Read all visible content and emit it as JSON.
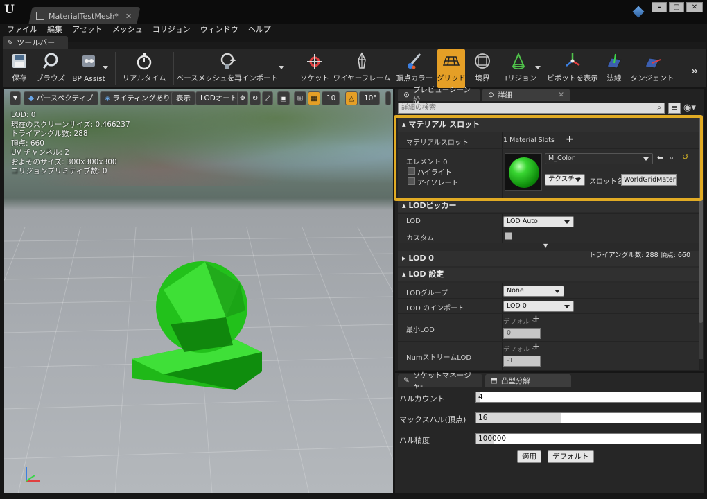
{
  "window": {
    "tab_title": "MaterialTestMesh*",
    "controls": [
      "minimize",
      "maximize",
      "close"
    ]
  },
  "menu": [
    "ファイル",
    "編集",
    "アセット",
    "メッシュ",
    "コリジョン",
    "ウィンドウ",
    "ヘルプ"
  ],
  "toolbar_tab": "ツールバー",
  "toolbar": {
    "save": "保存",
    "browse": "ブラウズ",
    "bp_assist": "BP Assist",
    "realtime": "リアルタイム",
    "reimport": "ベースメッシュを再インポート",
    "socket": "ソケット",
    "wireframe": "ワイヤーフレーム",
    "vertex_colors": "頂点カラー",
    "grid": "グリッド",
    "bounds": "境界",
    "collision": "コリジョン",
    "show_pivot": "ピボットを表示",
    "normals": "法線",
    "tangents": "タンジェント",
    "more": "»"
  },
  "viewport": {
    "perspective": "パースペクティブ",
    "lighting": "ライティングあり",
    "show": "表示",
    "lod_auto": "LODオート",
    "grid_snap": "10",
    "rot_snap": "10°",
    "stats": [
      "LOD: 0",
      "現在のスクリーンサイズ: 0.466237",
      "トライアングル数: 288",
      "頂点: 660",
      "UV チャンネル: 2",
      "およそのサイズ: 300x300x300",
      "コリジョンプリミティブ数: 0"
    ]
  },
  "right_panel": {
    "tab_preview": "プレビューシーン設",
    "tab_details": "詳細",
    "search_placeholder": "詳細の検索",
    "material_slots": {
      "header": "マテリアル スロット",
      "label": "マテリアルスロット",
      "count": "1 Material Slots",
      "element": "エレメント 0",
      "highlight": "ハイライト",
      "isolate": "アイソレート",
      "material": "M_Color",
      "texture_btn": "テクスチャ",
      "slot_name_label": "スロット名",
      "slot_name_value": "WorldGridMateria"
    },
    "lod_picker": {
      "header": "LODピッカー",
      "lod_label": "LOD",
      "lod_value": "LOD Auto",
      "custom_label": "カスタム"
    },
    "lod0": {
      "header": "LOD 0",
      "info": "トライアングル数: 288   頂点: 660"
    },
    "lod_settings": {
      "header": "LOD 設定",
      "group_label": "LODグループ",
      "group_value": "None",
      "import_label": "LOD のインポート",
      "import_value": "LOD 0",
      "min_lod_label": "最小LOD",
      "default_label": "デフォルト",
      "min_lod_value": "0",
      "num_stream_label": "NumストリームLOD",
      "num_stream_value": "-1"
    }
  },
  "bottom_panel": {
    "tab_socket": "ソケットマネージャ-",
    "tab_convex": "凸型分解",
    "hull_count_label": "ハルカウント",
    "hull_count": "4",
    "max_hull_label": "マックスハル(頂点)",
    "max_hull": "16",
    "hull_precision_label": "ハル精度",
    "hull_precision": "100000",
    "apply": "適用",
    "default": "デフォルト"
  },
  "colors": {
    "accent": "#e59f26",
    "highlight_box": "#e1ab24",
    "material_green": "#22c11b"
  }
}
